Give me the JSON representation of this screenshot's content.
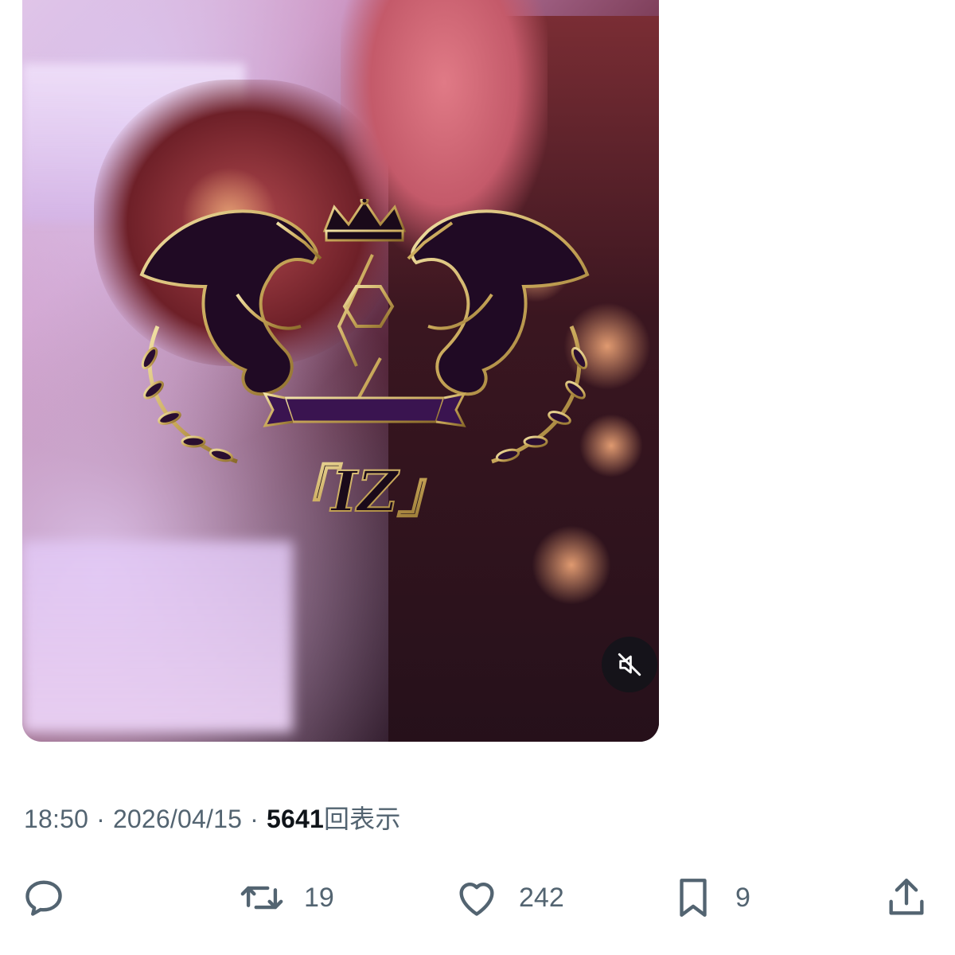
{
  "tweet": {
    "time": "18:50",
    "separator": "·",
    "date": "2026/04/15",
    "views_count": "5641",
    "views_label": "回表示"
  },
  "media": {
    "type": "video",
    "muted": true,
    "crest_text": "「IZ」"
  },
  "actions": {
    "reply": {
      "icon": "reply-icon"
    },
    "repost": {
      "icon": "repost-icon",
      "count": "19"
    },
    "like": {
      "icon": "heart-icon",
      "count": "242"
    },
    "bookmark": {
      "icon": "bookmark-icon",
      "count": "9"
    },
    "share": {
      "icon": "share-icon"
    }
  },
  "colors": {
    "secondary_text": "#536471",
    "primary_text": "#0f1419",
    "crest_gold": "#c9a85a",
    "crest_purple": "#4a1a6a"
  }
}
